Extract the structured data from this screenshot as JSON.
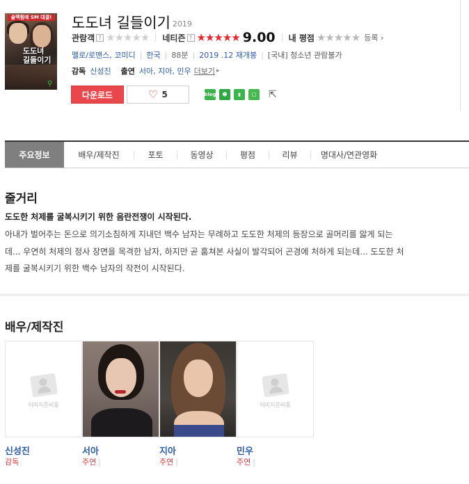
{
  "movie": {
    "title": "도도녀 길들이기",
    "year": "2019",
    "poster": {
      "tagline": "술맥힘에 SM 대결!",
      "title_text": "도도녀 길들이기"
    }
  },
  "ratings": {
    "audience_label": "관람객",
    "netizen_label": "네티즌",
    "netizen_score": "9.00",
    "my_rating_label": "내 평점",
    "register_label": "등록",
    "empty_stars": "★★★★★",
    "filled_stars": "★★★★★"
  },
  "info": {
    "genres": [
      "멜로/로맨스",
      "코미디"
    ],
    "country": "한국",
    "runtime": "88분",
    "release": "2019 .12 재개봉",
    "rating": "[국내] 청소년 관람불가"
  },
  "credits": {
    "director_label": "감독",
    "director": "신성진",
    "cast_label": "출연",
    "cast": "서아, 지아, 민우",
    "more_label": "더보기"
  },
  "actions": {
    "download_label": "다운로드",
    "like_count": "5",
    "share_icons": [
      "blog",
      "cafe",
      "bookmark",
      "band"
    ]
  },
  "tabs": [
    {
      "label": "주요정보",
      "active": true
    },
    {
      "label": "배우/제작진",
      "active": false
    },
    {
      "label": "포토",
      "active": false
    },
    {
      "label": "동영상",
      "active": false
    },
    {
      "label": "평점",
      "active": false
    },
    {
      "label": "리뷰",
      "active": false
    },
    {
      "label": "명대사/연관영화",
      "active": false
    }
  ],
  "synopsis": {
    "section_title": "줄거리",
    "headline": "도도한 처제를 굴복시키기 위한 음란전쟁이 시작된다.",
    "lines": [
      "아내가 벌어주는 돈으로 의기소침하게 지내던 백수 남자는 무례하고 도도한 처제의 등장으로 골머리를 앓게 되는",
      "데... 우연히 처제의 정사 장면을 목격한 남자, 하지만 곧 훔쳐본 사실이 발각되어 곤경에 처하게 되는데... 도도한 처",
      "제를 굴복시키기 위한 백수 남자의 작전이 시작된다."
    ]
  },
  "cast_section": {
    "section_title": "배우/제작진",
    "placeholder_text": "이미지준비중",
    "people": [
      {
        "name": "신성진",
        "role": "감독",
        "photo": "none"
      },
      {
        "name": "서아",
        "role": "주연",
        "photo": "real"
      },
      {
        "name": "지아",
        "role": "주연",
        "photo": "real"
      },
      {
        "name": "민우",
        "role": "주연",
        "photo": "none"
      }
    ]
  },
  "colors": {
    "accent_red": "#e9474b",
    "link_blue": "#2a5aa8",
    "tab_active_bg": "#7f7f7f"
  }
}
